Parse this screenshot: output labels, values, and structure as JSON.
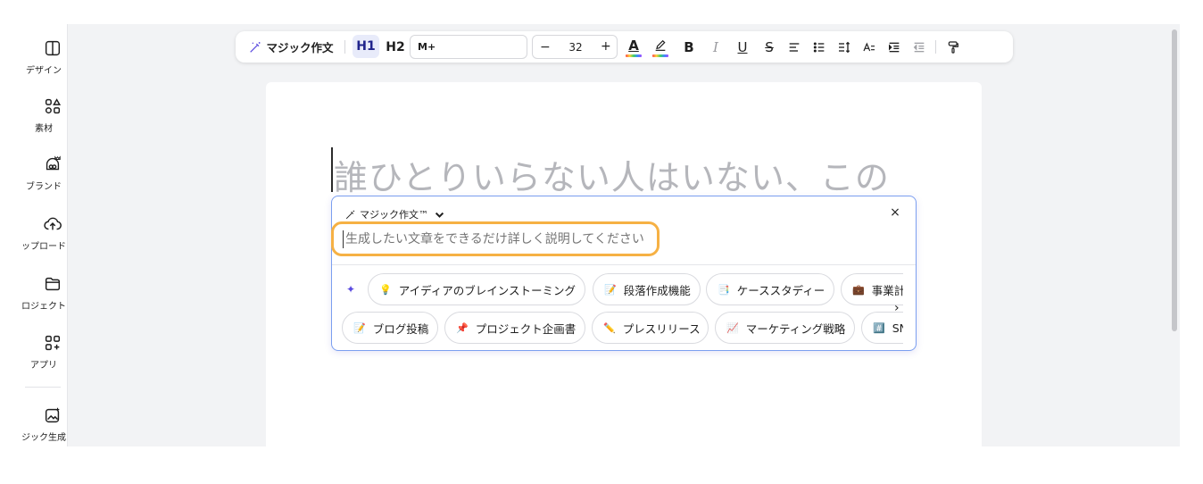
{
  "sidebar": {
    "items": [
      {
        "label": "デザイン",
        "icon": "layout-icon"
      },
      {
        "label": "素材",
        "icon": "shapes-icon"
      },
      {
        "label": "ブランド",
        "icon": "brand-icon"
      },
      {
        "label": "ップロード",
        "icon": "upload-cloud-icon"
      },
      {
        "label": "ロジェクト",
        "icon": "folder-icon"
      },
      {
        "label": "アプリ",
        "icon": "apps-icon"
      },
      {
        "label": "ジック生成",
        "icon": "magic-media-icon"
      }
    ]
  },
  "toolbar": {
    "magic_write_label": "マジック作文",
    "h1_label": "H1",
    "h2_label": "H2",
    "font_name": "M+",
    "font_size": "32",
    "minus_label": "−",
    "plus_label": "+",
    "bold_label": "B",
    "italic_label": "I",
    "underline_label": "U",
    "strike_label": "S"
  },
  "document": {
    "heading_text": "誰ひとりいらない人はいない、この"
  },
  "magic_panel": {
    "title": "マジック作文™",
    "close_label": "×",
    "prompt_placeholder": "生成したい文章をできるだけ詳しく説明してください",
    "chips_row1": [
      {
        "icon": "💡",
        "label": "アイディアのブレインストーミング"
      },
      {
        "icon": "📝",
        "label": "段落作成機能"
      },
      {
        "icon": "📑",
        "label": "ケーススタディー"
      },
      {
        "icon": "💼",
        "label": "事業計"
      }
    ],
    "chips_row2": [
      {
        "icon": "📝",
        "label": "ブログ投稿"
      },
      {
        "icon": "📌",
        "label": "プロジェクト企画書"
      },
      {
        "icon": "✏️",
        "label": "プレスリリース"
      },
      {
        "icon": "📈",
        "label": "マーケティング戦略"
      },
      {
        "icon": "#️⃣",
        "label": "SN"
      }
    ]
  },
  "colors": {
    "accent_orange": "#f6b144",
    "panel_border": "#7b9ff0",
    "h1_active_bg": "#e8ebfa",
    "sparkle": "#5b4be0"
  }
}
